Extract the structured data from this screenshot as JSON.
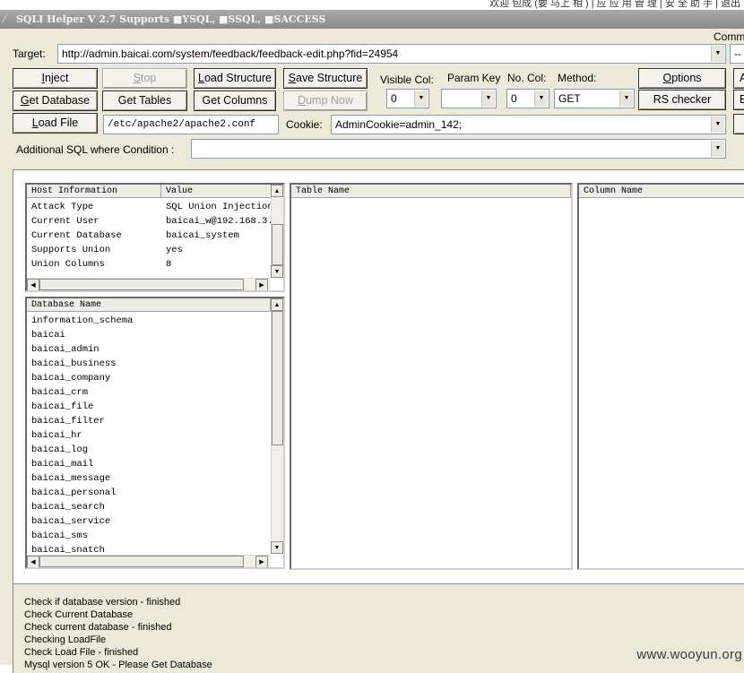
{
  "top_strip": "欢迎 包成 (要 马上 相  ) |  应 应 用 管 理 | 安 全 助 手 | 退出",
  "window": {
    "title": "SQLI Helper V 2.7 Supports ■YSQL, ■SSQL, ■SACCESS"
  },
  "target": {
    "label": "Target:",
    "value": "http://admin.baicai.com/system/feedback/feedback-edit.php?fid=24954"
  },
  "comment": {
    "label": "Comm",
    "value": "--"
  },
  "buttons": {
    "inject": "Inject",
    "stop": "Stop",
    "load_structure": "Load Structure",
    "save_structure": "Save Structure",
    "get_database": "Get Database",
    "get_tables": "Get Tables",
    "get_columns": "Get Columns",
    "dump_now": "Dump Now",
    "load_file": "Load File",
    "options": "Options",
    "rs_checker": "RS checker",
    "right_a": "A",
    "right_e": "E"
  },
  "options": {
    "visible_col_label": "Visible Col:",
    "visible_col_value": "0",
    "param_key_label": "Param Key",
    "param_key_value": "",
    "no_col_label": "No. Col:",
    "no_col_value": "0",
    "method_label": "Method:",
    "method_value": "GET"
  },
  "load_file_path": "/etc/apache2/apache2.conf",
  "cookie": {
    "label": "Cookie:",
    "value": "AdminCookie=admin_142;"
  },
  "where": {
    "label": "Additional SQL where Condition :",
    "value": ""
  },
  "host_info": {
    "headers": [
      "Host Information",
      "Value"
    ],
    "rows": [
      [
        "Attack Type",
        "SQL Union Injection"
      ],
      [
        "Current User",
        "baicai_w@192.168.3."
      ],
      [
        "Current Database",
        "baicai_system"
      ],
      [
        "Supports Union",
        "yes"
      ],
      [
        "Union Columns",
        "8"
      ]
    ]
  },
  "databases": {
    "header": "Database Name",
    "items": [
      "information_schema",
      "baicai",
      "baicai_admin",
      "baicai_business",
      "baicai_company",
      "baicai_crm",
      "baicai_file",
      "baicai_filter",
      "baicai_hr",
      "baicai_log",
      "baicai_mail",
      "baicai_message",
      "baicai_personal",
      "baicai_search",
      "baicai_service",
      "baicai_sms",
      "baicai_snatch"
    ]
  },
  "tables": {
    "header": "Table Name"
  },
  "columns": {
    "header": "Column Name"
  },
  "log": [
    "Check if database version - finished",
    "Check Current Database",
    "Check current database - finished",
    "Checking LoadFile",
    "Check Load File - finished",
    "Mysql version 5 OK - Please Get Database"
  ],
  "watermark": "www.wooyun.org"
}
